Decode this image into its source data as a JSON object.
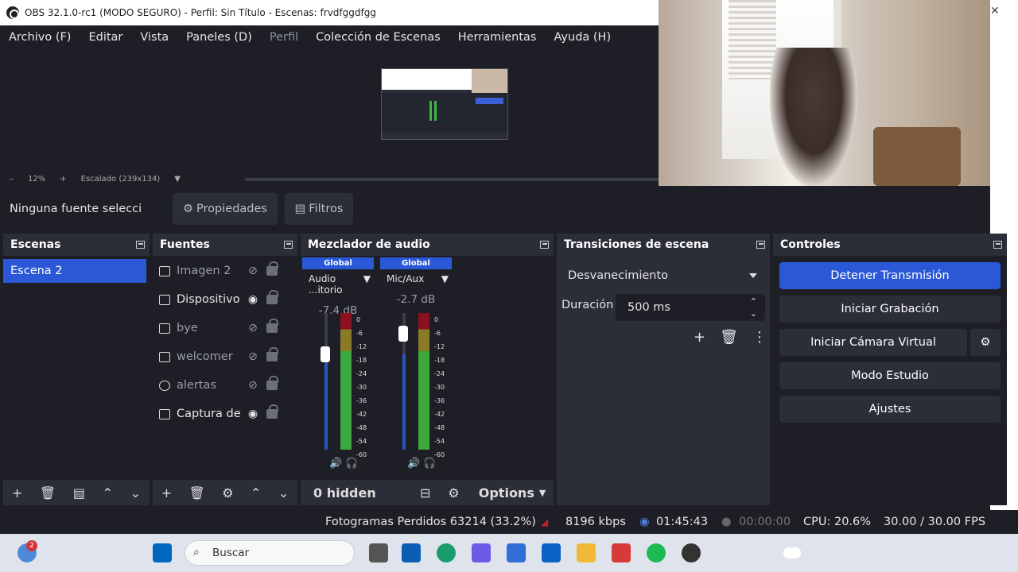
{
  "window": {
    "title": "OBS 32.1.0-rc1 (MODO SEGURO) - Perfil: Sin Título - Escenas: frvdfggdfgg"
  },
  "menu": [
    {
      "label": "Archivo (F)"
    },
    {
      "label": "Editar"
    },
    {
      "label": "Vista"
    },
    {
      "label": "Paneles (D)"
    },
    {
      "label": "Perfil"
    },
    {
      "label": "Colección de Escenas"
    },
    {
      "label": "Herramientas"
    },
    {
      "label": "Ayuda (H)"
    }
  ],
  "zoom": {
    "minus": "–",
    "percent": "12%",
    "plus": "+",
    "scale_label": "Escalado (239x134)"
  },
  "source_bar": {
    "no_selection": "Ninguna fuente selecci",
    "properties": "Propiedades",
    "filters": "Filtros"
  },
  "scenes": {
    "title": "Escenas",
    "items": [
      {
        "label": "Escena 2"
      }
    ]
  },
  "sources": {
    "title": "Fuentes",
    "items": [
      {
        "label": "Imagen 2",
        "visible": false
      },
      {
        "label": "Dispositivo",
        "visible": true
      },
      {
        "label": "bye",
        "visible": false
      },
      {
        "label": "welcomer",
        "visible": false
      },
      {
        "label": "alertas",
        "visible": false
      },
      {
        "label": "Captura de",
        "visible": true
      }
    ]
  },
  "mixer": {
    "title": "Mezclador de audio",
    "channels": [
      {
        "global": "Global",
        "name": "Audio ...itorio",
        "db": "-7.4 dB"
      },
      {
        "global": "Global",
        "name": "Mic/Aux",
        "db": "-2.7 dB"
      }
    ],
    "scale": [
      "0",
      "-6",
      "-12",
      "-18",
      "-24",
      "-30",
      "-36",
      "-42",
      "-48",
      "-54",
      "-60"
    ],
    "hidden": "0 hidden",
    "options": "Options"
  },
  "transitions": {
    "title": "Transiciones de escena",
    "selected": "Desvanecimiento",
    "duration_label": "Duración",
    "duration_value": "500 ms"
  },
  "controls": {
    "title": "Controles",
    "stop_stream": "Detener Transmisión",
    "start_recording": "Iniciar Grabación",
    "virtual_camera": "Iniciar Cámara Virtual",
    "studio_mode": "Modo Estudio",
    "settings": "Ajustes"
  },
  "status": {
    "dropped_frames": "Fotogramas Perdidos 63214 (33.2%)",
    "bitrate": "8196 kbps",
    "stream_time": "01:45:43",
    "record_time": "00:00:00",
    "cpu": "CPU: 20.6%",
    "fps": "30.00 / 30.00 FPS"
  },
  "taskbar": {
    "search_placeholder": "Buscar",
    "notification_count": "2"
  },
  "colors": {
    "accent": "#2a58d6",
    "panel": "#2b2d39",
    "background": "#1e1f26"
  }
}
